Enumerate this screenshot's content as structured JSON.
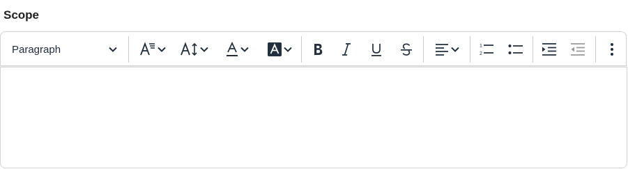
{
  "field": {
    "label": "Scope"
  },
  "toolbar": {
    "block_format": {
      "selected": "Paragraph",
      "icon": "chevron-down-icon"
    },
    "buttons": [
      {
        "name": "font-family",
        "icon": "font-family-icon"
      },
      {
        "name": "font-size",
        "icon": "font-size-icon"
      },
      {
        "name": "text-color",
        "icon": "text-color-icon"
      },
      {
        "name": "background-color",
        "icon": "highlight-icon"
      },
      {
        "name": "bold",
        "icon": "bold-icon"
      },
      {
        "name": "italic",
        "icon": "italic-icon"
      },
      {
        "name": "underline",
        "icon": "underline-icon"
      },
      {
        "name": "strikethrough",
        "icon": "strikethrough-icon"
      },
      {
        "name": "align",
        "icon": "align-left-icon"
      },
      {
        "name": "numbered-list",
        "icon": "numbered-list-icon"
      },
      {
        "name": "bullet-list",
        "icon": "bullet-list-icon"
      },
      {
        "name": "indent",
        "icon": "indent-icon"
      },
      {
        "name": "outdent",
        "icon": "outdent-icon"
      },
      {
        "name": "more",
        "icon": "more-vertical-icon"
      }
    ],
    "icon_color": "#222f3e",
    "disabled_color": "#9a9a9a"
  },
  "editor": {
    "content": ""
  }
}
